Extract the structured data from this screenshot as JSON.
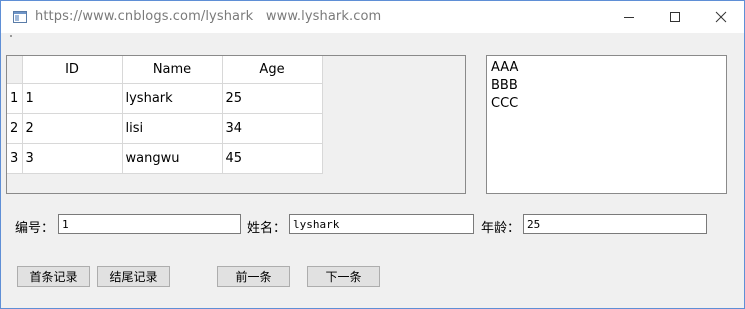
{
  "window": {
    "title": "https://www.cnblogs.com/lyshark   www.lyshark.com"
  },
  "table": {
    "headers": [
      "ID",
      "Name",
      "Age"
    ],
    "row_numbers": [
      "1",
      "2",
      "3"
    ],
    "rows": [
      [
        "1",
        "lyshark",
        "25"
      ],
      [
        "2",
        "lisi",
        "34"
      ],
      [
        "3",
        "wangwu",
        "45"
      ]
    ]
  },
  "list": {
    "items": [
      "AAA",
      "BBB",
      "CCC"
    ]
  },
  "form": {
    "id_label": "编号：",
    "id_value": "1",
    "name_label": "姓名：",
    "name_value": "lyshark",
    "age_label": "年龄：",
    "age_value": "25"
  },
  "buttons": {
    "first": "首条记录",
    "last": "结尾记录",
    "prev": "前一条",
    "next": "下一条"
  },
  "icons": {
    "app": "app-window-icon",
    "minimize": "minimize-icon",
    "maximize": "maximize-icon",
    "close": "close-icon"
  }
}
